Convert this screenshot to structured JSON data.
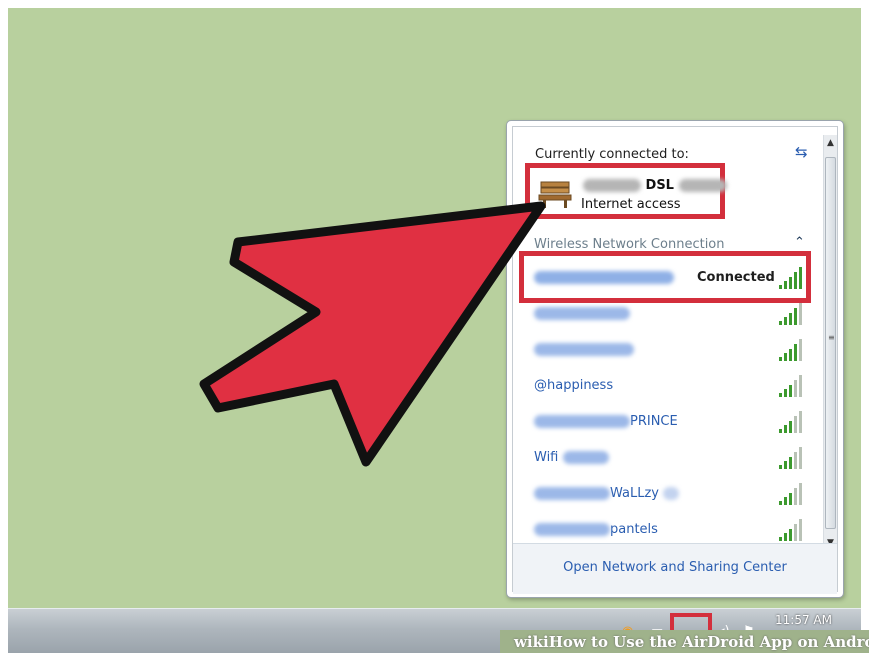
{
  "panel": {
    "currently_connected_label": "Currently connected to:",
    "current_network": {
      "name_suffix": "DSL",
      "status": "Internet access"
    },
    "section_label": "Wireless Network Connection",
    "connected_label": "Connected",
    "networks": [
      {
        "prefix_blur": "",
        "visible_text": "",
        "strength": 5
      },
      {
        "prefix_blur": "",
        "visible_text": "",
        "strength": 4
      },
      {
        "prefix_blur": "",
        "visible_text": "",
        "strength": 4
      },
      {
        "prefix_blur": "",
        "visible_text": "@happiness",
        "strength": 3
      },
      {
        "prefix_blur": "",
        "visible_text": "PRINCE",
        "strength": 3
      },
      {
        "prefix_blur": "",
        "visible_text": "Wifi",
        "strength": 3
      },
      {
        "prefix_blur": "",
        "visible_text": "WaLLzy",
        "strength": 3
      },
      {
        "prefix_blur": "",
        "visible_text": "pantels",
        "strength": 3
      }
    ],
    "footer_link": "Open Network and Sharing Center"
  },
  "taskbar": {
    "clock": "11:57 AM"
  },
  "watermark": "wikiHow to Use the AirDroid App on Android",
  "colors": {
    "desktop": "#b8d09e",
    "highlight": "#d32f3c",
    "link": "#2a5db0",
    "signal": "#3c9a2e"
  },
  "icons": {
    "refresh": "refresh-icon",
    "network": "bench-icon",
    "collapse": "chevron-up-icon",
    "signal": "signal-bars-icon",
    "arrow": "pointer-arrow"
  }
}
